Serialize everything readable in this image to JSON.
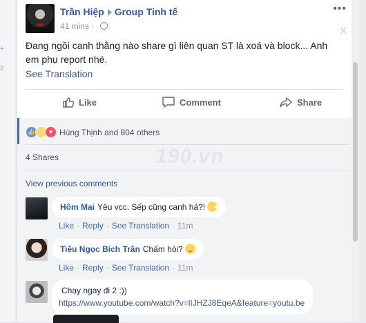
{
  "left_strip": {
    "marks": [
      "+",
      "2"
    ]
  },
  "post": {
    "author": "Trần Hiệp",
    "group": "Group Tinh tế",
    "time": "41 mins",
    "more_icon": "more-horizontal-icon",
    "close_label": "X",
    "text": "Đang ngồi canh thằng nào share gì liên quan ST là xoá và block... Anh em phụ report nhé.",
    "see_translation": "See Translation"
  },
  "actions": {
    "like": "Like",
    "comment": "Comment",
    "share": "Share"
  },
  "reactions": {
    "summary": "Hùng Thịnh and 804 others",
    "types": [
      "like",
      "haha",
      "love"
    ]
  },
  "shares": "4 Shares",
  "view_previous": "View previous comments",
  "comments": [
    {
      "name": "Hôm Mai",
      "text": "Yêu vcc. Sếp cũng canh hả?!",
      "like": "Like",
      "reply": "Reply",
      "translate": "See Translation",
      "time": "11m"
    },
    {
      "name": "Tiêu Ngọc Bích Trân",
      "text": "Chấm hỏi?",
      "like": "Like",
      "reply": "Reply",
      "translate": "See Translation",
      "time": "11m"
    },
    {
      "name": "",
      "text": "Chạy ngay đi 2 :))",
      "link": "https://www.youtube.com/watch?v=lIJHZJ8EqeA&feature=youtu.be"
    }
  ],
  "watermark": "190.vn",
  "colors": {
    "link": "#365899",
    "meta": "#90949c",
    "bg": "#e9ebee",
    "comment_bg": "#f2f3f5"
  }
}
